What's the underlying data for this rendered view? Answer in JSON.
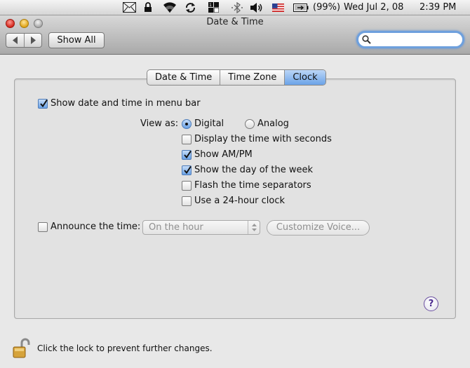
{
  "menubar": {
    "battery": "(99%)",
    "date": "Wed Jul 2, 08",
    "time": "2:39 PM",
    "icons": [
      "mail-icon",
      "lock-icon",
      "wifi-icon",
      "sync-icon",
      "spaces-icon",
      "bluetooth-icon",
      "volume-icon",
      "us-flag-icon",
      "battery-icon"
    ]
  },
  "window": {
    "title": "Date & Time",
    "show_all": "Show All",
    "search": {
      "value": "",
      "placeholder": ""
    }
  },
  "tabs": [
    {
      "label": "Date & Time",
      "active": false
    },
    {
      "label": "Time Zone",
      "active": false
    },
    {
      "label": "Clock",
      "active": true
    }
  ],
  "clock": {
    "show_in_menu_bar": {
      "label": "Show date and time in menu bar",
      "checked": true
    },
    "view_as_label": "View as:",
    "digital": {
      "label": "Digital",
      "selected": true
    },
    "analog": {
      "label": "Analog",
      "selected": false
    },
    "options": [
      {
        "label": "Display the time with seconds",
        "checked": false
      },
      {
        "label": "Show AM/PM",
        "checked": true
      },
      {
        "label": "Show the day of the week",
        "checked": true
      },
      {
        "label": "Flash the time separators",
        "checked": false
      },
      {
        "label": "Use a 24-hour clock",
        "checked": false
      }
    ],
    "announce": {
      "label": "Announce the time:",
      "checked": false
    },
    "interval_popup": "On the hour",
    "customize_voice": "Customize Voice..."
  },
  "help": "?",
  "footer": {
    "lock_text": "Click the lock to prevent further changes."
  },
  "colors": {
    "accent": "#6ba3e8",
    "toolbar": "#bcbcbc",
    "panel": "#e2e2e2"
  }
}
